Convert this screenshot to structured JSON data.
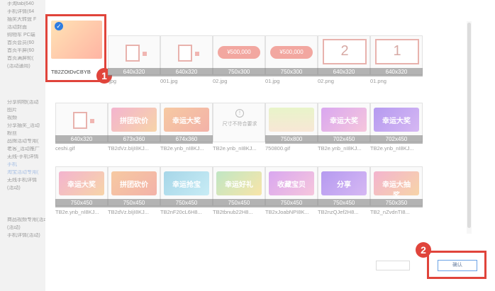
{
  "sidebar": {
    "items": [
      "手淘tab(640",
      "手机详情(64",
      "抽奖大转盘 F",
      "活动封面",
      "购物车 PC端",
      "首页会员(60",
      "首页半屏(60",
      "首页满屏轮(",
      "(活动通用)",
      "分享购物(活动",
      "图片",
      "视频",
      "分享抽奖_活动",
      "粉丝",
      "品牌活动专用(",
      "老客_活动推广",
      "无线-手机详情",
      "手机",
      "淘宝活动专用(",
      "无线手机详情",
      "(活动)",
      "商品视频专用(活动",
      "(活动)",
      "手机详情(活动)"
    ]
  },
  "selected_image": {
    "filename": "TB2ZOtDvCBYB"
  },
  "images": [
    {
      "dim": "640x320",
      "name": ".jpg"
    },
    {
      "dim": "640x320",
      "name": "001.jpg"
    },
    {
      "dim": "750x300",
      "name": "02.jpg",
      "pill": "¥500,000"
    },
    {
      "dim": "750x300",
      "name": "01.jpg",
      "pill": "¥500,000"
    },
    {
      "dim": "640x320",
      "name": "02.png",
      "digit": "2"
    },
    {
      "dim": "640x320",
      "name": "01.png",
      "digit": "1"
    },
    {
      "dim": "640x320",
      "name": "ceshi.gif"
    },
    {
      "dim": "673x360",
      "name": "TB2dVz.bIjI8KJ...",
      "banner": "拼团砍价"
    },
    {
      "dim": "674x360",
      "name": "TB2e.ynb_nI8KJ...",
      "banner": "幸运大奖"
    },
    {
      "note": "尺寸不符合要求",
      "name": "TB2e.ynb_nI8KJ..."
    },
    {
      "dim": "750x800",
      "name": "750800.gif"
    },
    {
      "dim": "702x450",
      "name": "TB2e.ynb_nI8KJ...",
      "banner": "幸运大奖"
    },
    {
      "dim": "702x450",
      "name": "TB2e.ynb_nI8KJ...",
      "banner": "幸运大奖"
    },
    {
      "dim": "750x450",
      "name": "TB2e.ynb_nI8KJ...",
      "banner": "幸运大奖"
    },
    {
      "dim": "750x450",
      "name": "TB2dVz.bIjI8KJ...",
      "banner": "拼团砍价"
    },
    {
      "dim": "750x450",
      "name": "TB2nF20cL6H8...",
      "banner": "幸运抢宝"
    },
    {
      "dim": "750x450",
      "name": "TB2tbnub22H8...",
      "banner": "幸运好礼"
    },
    {
      "dim": "750x450",
      "name": "TB2xJoabNPI8K...",
      "banner": "收藏宝贝"
    },
    {
      "dim": "750x450",
      "name": "TB2nzQJef2H8...",
      "banner": "分享"
    },
    {
      "dim": "750x350",
      "name": "TB2_nZvdnTI8...",
      "banner": "幸运大抽奖"
    }
  ],
  "callouts": {
    "one": "1",
    "two": "2"
  },
  "confirm_button": {
    "label": "确认"
  }
}
